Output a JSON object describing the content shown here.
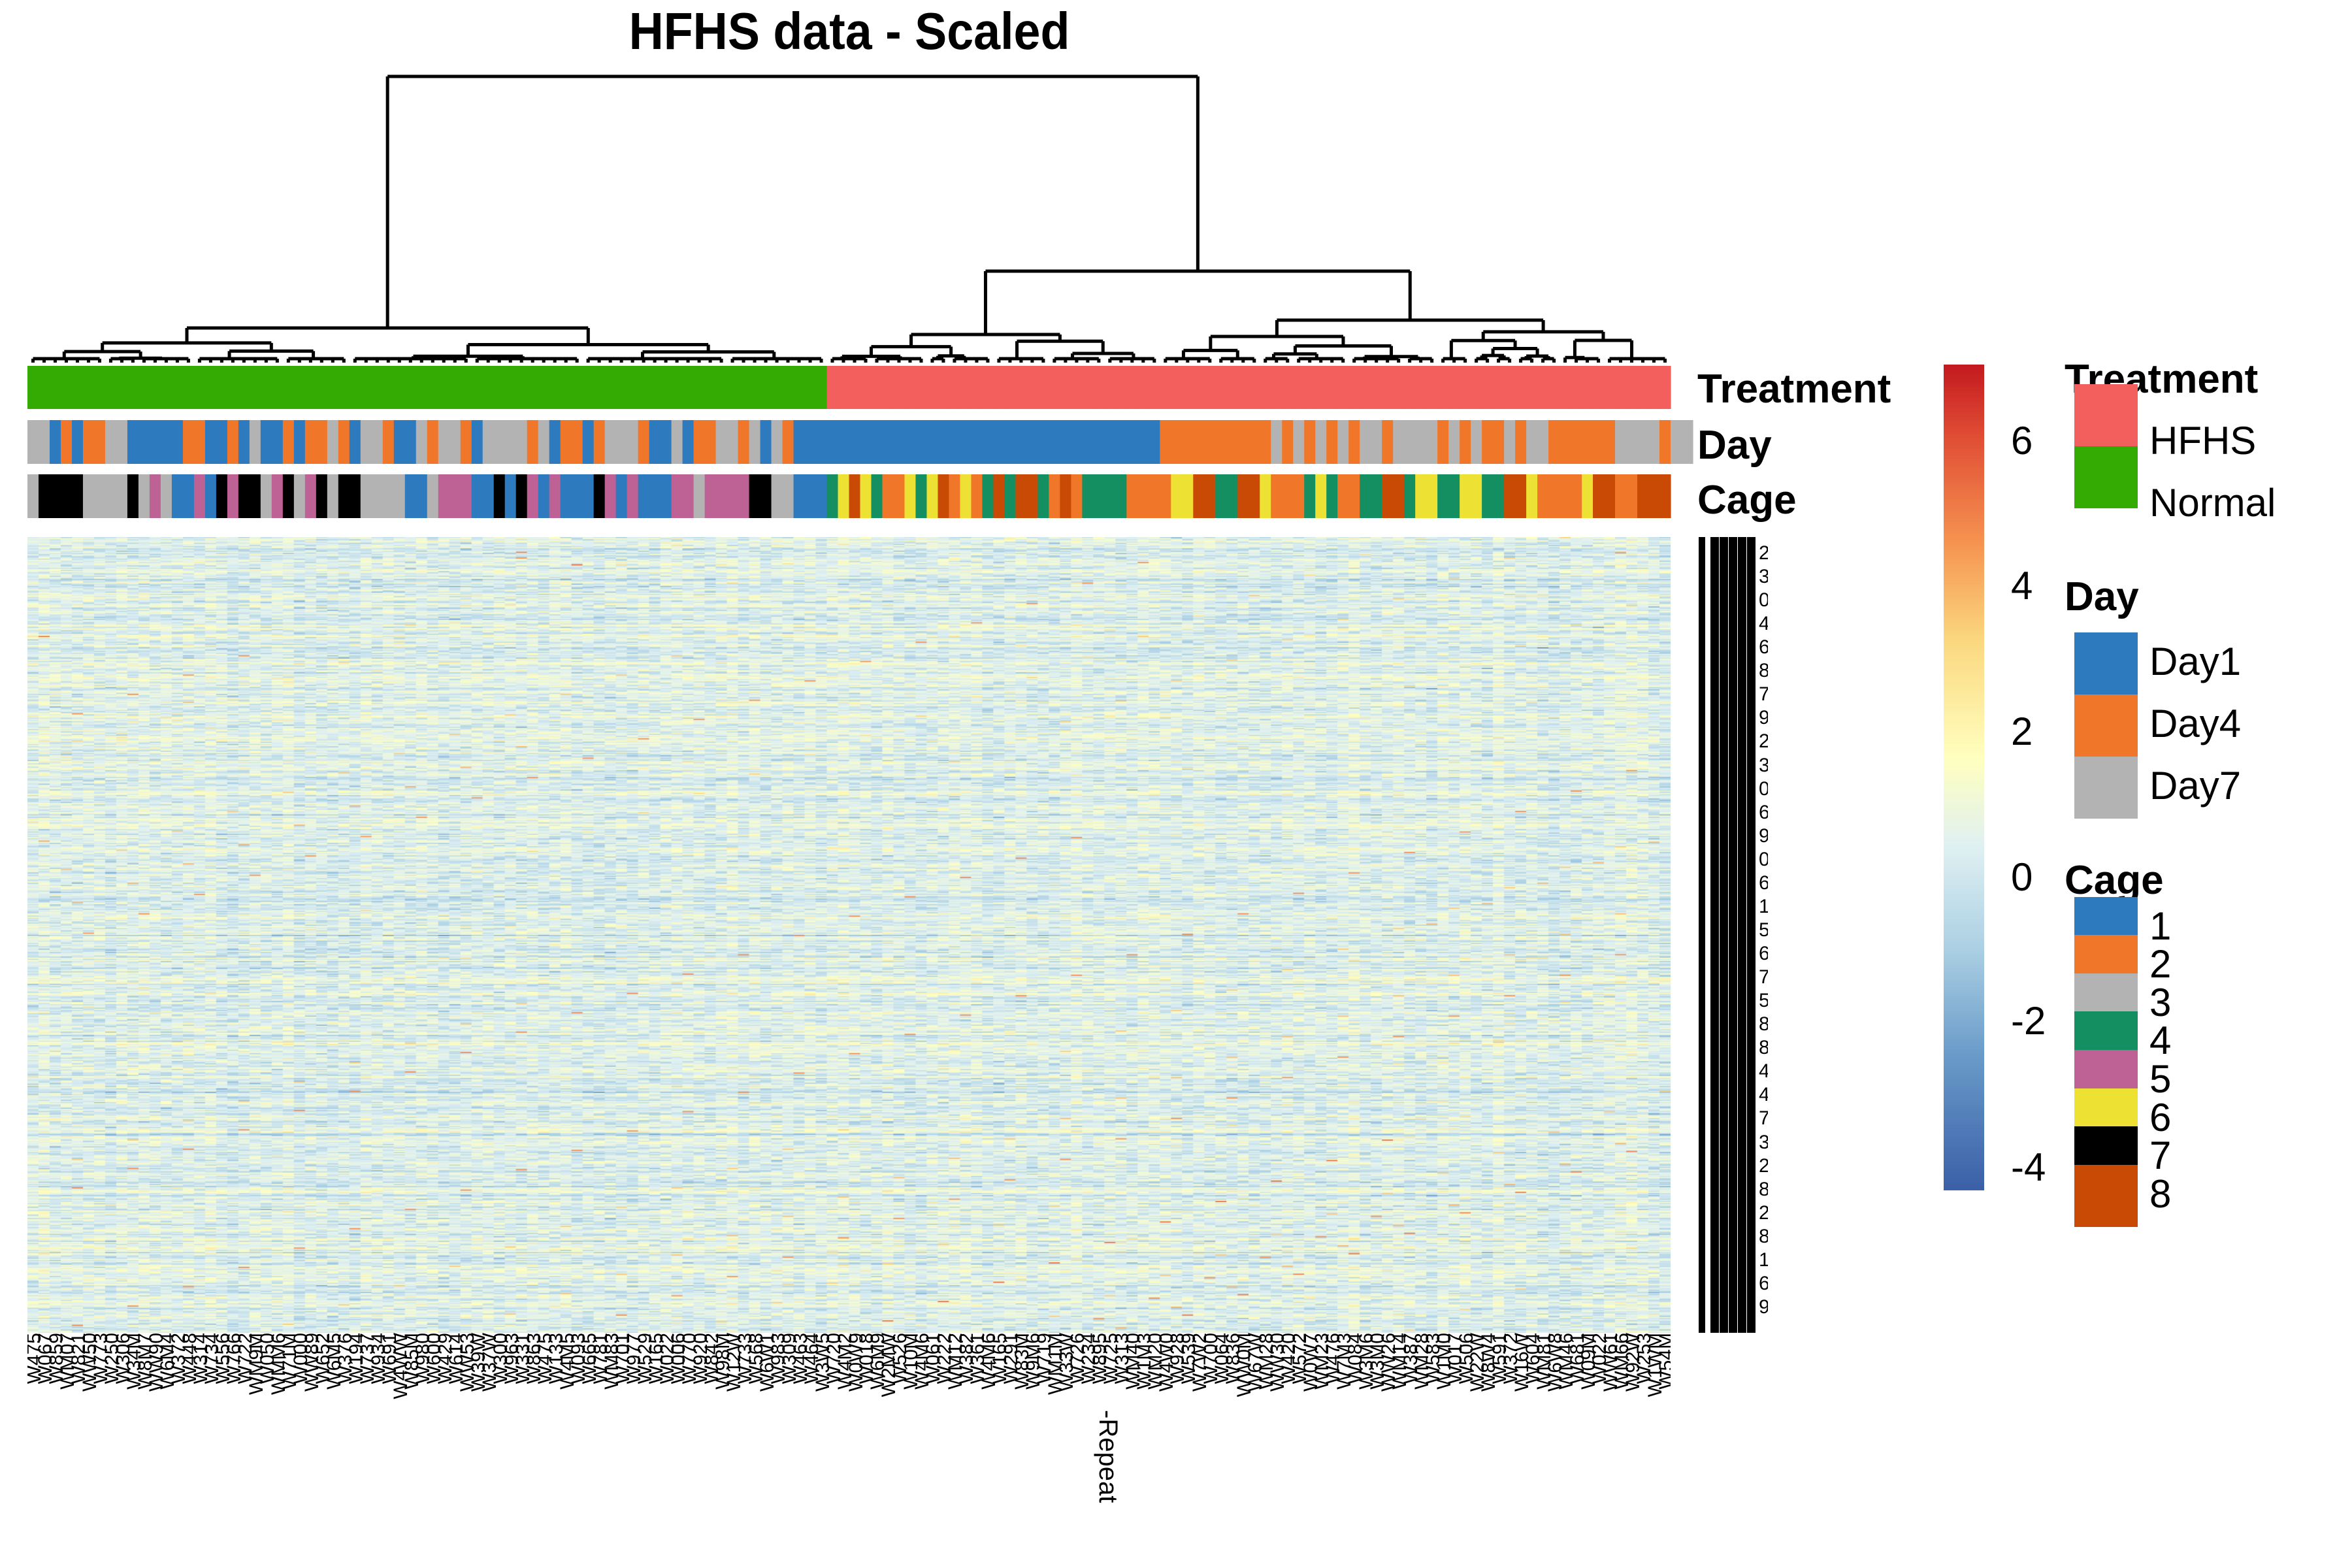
{
  "chart_data": {
    "type": "heatmap",
    "title": "HFHS data - Scaled",
    "n_columns": 148,
    "n_rows_approx": 700,
    "column_labels_note": "sample IDs rendered rotated and heavily overlapped (illegible)",
    "visible_column_label_fragment": "-Repeat",
    "row_labels_note": "feature IDs rendered heavily overlapped (illegible)",
    "visible_row_label_digits": [
      "2",
      "3",
      "0",
      "4",
      "6",
      "8",
      "7",
      "9",
      "2",
      "3",
      "0",
      "6",
      "9",
      "0",
      "6",
      "1",
      "5",
      "6",
      "7",
      "5",
      "8",
      "8",
      "4",
      "4",
      "7",
      "3",
      "2",
      "8",
      "2",
      "8",
      "1",
      "6",
      "9"
    ],
    "value_scale": {
      "min": -5,
      "max": 7,
      "ticks": [
        6,
        4,
        2,
        0,
        -2,
        -4
      ],
      "colors": [
        "#3a5fa8",
        "#6a9bc9",
        "#aacfe3",
        "#dff0f2",
        "#ffffbf",
        "#fbd880",
        "#f5904f",
        "#e04c34",
        "#c41a1f"
      ],
      "stops": [
        -5,
        -3,
        -1.5,
        0,
        1.3,
        3,
        4.5,
        6,
        7
      ]
    },
    "dendrogram": {
      "orientation": "columns",
      "top_split": "Normal vs HFHS",
      "hfhs_subsplit": "Day1 vs Day4/Day7"
    },
    "annotations": {
      "rows": [
        "Treatment",
        "Day",
        "Cage"
      ],
      "Treatment": "NNNNNNNNNNNNNNNNNNNNNNNNNNNNNNNNNNNNNNNNNNNNNNNNNNNNNNNNNNNNNNNNNNNNNNNNNNNNNNNNHHHHHHHHHHHHHHHHHHHHHHHHHHHHHHHHHHHHHHHHHHHHHHHHHHHHHHHHHHHHHHHHHH",
      "Day": "77141447711111441414711444714471144171144777714771411711777741471171441144111444111111111111111111111111114444444444477474747477477477777777474744477474744444444777777777474477",
      "Cage": "37773777373521517577377775511535575377375557777115757115551733551117555557731"
    },
    "annotation_sequences": {
      "Treatment": [
        "Normal",
        "Normal",
        "Normal",
        "Normal",
        "Normal",
        "Normal",
        "Normal",
        "Normal",
        "Normal",
        "Normal",
        "Normal",
        "Normal",
        "Normal",
        "Normal",
        "Normal",
        "Normal",
        "Normal",
        "Normal",
        "Normal",
        "Normal",
        "Normal",
        "Normal",
        "Normal",
        "Normal",
        "Normal",
        "Normal",
        "Normal",
        "Normal",
        "Normal",
        "Normal",
        "Normal",
        "Normal",
        "Normal",
        "Normal",
        "Normal",
        "Normal",
        "Normal",
        "Normal",
        "Normal",
        "Normal",
        "Normal",
        "Normal",
        "Normal",
        "Normal",
        "Normal",
        "Normal",
        "Normal",
        "Normal",
        "Normal",
        "Normal",
        "Normal",
        "Normal",
        "Normal",
        "Normal",
        "Normal",
        "Normal",
        "Normal",
        "Normal",
        "Normal",
        "Normal",
        "Normal",
        "Normal",
        "Normal",
        "Normal",
        "Normal",
        "Normal",
        "Normal",
        "Normal",
        "Normal",
        "Normal",
        "Normal",
        "Normal",
        "HFHS",
        "HFHS",
        "HFHS",
        "HFHS",
        "HFHS",
        "HFHS",
        "HFHS",
        "HFHS",
        "HFHS",
        "HFHS",
        "HFHS",
        "HFHS",
        "HFHS",
        "HFHS",
        "HFHS",
        "HFHS",
        "HFHS",
        "HFHS",
        "HFHS",
        "HFHS",
        "HFHS",
        "HFHS",
        "HFHS",
        "HFHS",
        "HFHS",
        "HFHS",
        "HFHS",
        "HFHS",
        "HFHS",
        "HFHS",
        "HFHS",
        "HFHS",
        "HFHS",
        "HFHS",
        "HFHS",
        "HFHS",
        "HFHS",
        "HFHS",
        "HFHS",
        "HFHS",
        "HFHS",
        "HFHS",
        "HFHS",
        "HFHS",
        "HFHS",
        "HFHS",
        "HFHS",
        "HFHS",
        "HFHS",
        "HFHS",
        "HFHS",
        "HFHS",
        "HFHS",
        "HFHS",
        "HFHS",
        "HFHS",
        "HFHS",
        "HFHS",
        "HFHS",
        "HFHS",
        "HFHS",
        "HFHS",
        "HFHS",
        "HFHS",
        "HFHS",
        "HFHS",
        "HFHS",
        "HFHS",
        "HFHS",
        "HFHS",
        "HFHS",
        "HFHS",
        "HFHS",
        "HFHS",
        "HFHS",
        "HFHS"
      ],
      "Day": [
        "Day7",
        "Day7",
        "Day1",
        "Day4",
        "Day1",
        "Day4",
        "Day4",
        "Day7",
        "Day7",
        "Day1",
        "Day1",
        "Day1",
        "Day1",
        "Day1",
        "Day4",
        "Day4",
        "Day1",
        "Day1",
        "Day4",
        "Day1",
        "Day7",
        "Day1",
        "Day1",
        "Day4",
        "Day1",
        "Day4",
        "Day4",
        "Day7",
        "Day4",
        "Day1",
        "Day7",
        "Day7",
        "Day4",
        "Day1",
        "Day1",
        "Day7",
        "Day4",
        "Day7",
        "Day7",
        "Day4",
        "Day1",
        "Day7",
        "Day7",
        "Day7",
        "Day7",
        "Day4",
        "Day7",
        "Day1",
        "Day4",
        "Day4",
        "Day1",
        "Day4",
        "Day7",
        "Day7",
        "Day7",
        "Day4",
        "Day1",
        "Day1",
        "Day7",
        "Day1",
        "Day4",
        "Day4",
        "Day7",
        "Day7",
        "Day4",
        "Day7",
        "Day1",
        "Day7",
        "Day4",
        "Day1",
        "Day1",
        "Day1",
        "Day1",
        "Day1",
        "Day1",
        "Day1",
        "Day1",
        "Day1",
        "Day1",
        "Day1",
        "Day1",
        "Day1",
        "Day1",
        "Day1",
        "Day1",
        "Day1",
        "Day1",
        "Day1",
        "Day1",
        "Day1",
        "Day1",
        "Day1",
        "Day1",
        "Day1",
        "Day1",
        "Day1",
        "Day1",
        "Day1",
        "Day1",
        "Day1",
        "Day1",
        "Day1",
        "Day4",
        "Day4",
        "Day4",
        "Day4",
        "Day4",
        "Day4",
        "Day4",
        "Day4",
        "Day4",
        "Day4",
        "Day7",
        "Day4",
        "Day7",
        "Day4",
        "Day7",
        "Day4",
        "Day7",
        "Day4",
        "Day7",
        "Day7",
        "Day4",
        "Day7",
        "Day7",
        "Day7",
        "Day7",
        "Day4",
        "Day7",
        "Day4",
        "Day7",
        "Day4",
        "Day4",
        "Day7",
        "Day4",
        "Day7",
        "Day7",
        "Day4",
        "Day4",
        "Day4",
        "Day4",
        "Day4",
        "Day4",
        "Day7",
        "Day7",
        "Day7",
        "Day7",
        "Day4",
        "Day7",
        "Day7"
      ],
      "Cage": [
        "3",
        "7",
        "7",
        "7",
        "7",
        "3",
        "3",
        "3",
        "3",
        "7",
        "3",
        "5",
        "3",
        "1",
        "1",
        "5",
        "1",
        "7",
        "5",
        "7",
        "7",
        "3",
        "5",
        "7",
        "3",
        "5",
        "7",
        "3",
        "7",
        "7",
        "3",
        "3",
        "3",
        "3",
        "1",
        "1",
        "3",
        "5",
        "5",
        "5",
        "1",
        "1",
        "7",
        "1",
        "7",
        "5",
        "1",
        "5",
        "1",
        "1",
        "1",
        "7",
        "5",
        "1",
        "5",
        "1",
        "1",
        "1",
        "5",
        "5",
        "3",
        "5",
        "5",
        "5",
        "5",
        "7",
        "7",
        "3",
        "3",
        "1",
        "1",
        "1",
        "4",
        "6",
        "8",
        "6",
        "4",
        "2",
        "2",
        "6",
        "4",
        "6",
        "8",
        "2",
        "6",
        "2",
        "4",
        "8",
        "4",
        "8",
        "8",
        "4",
        "2",
        "8",
        "2",
        "4",
        "4",
        "4",
        "4",
        "2",
        "2",
        "2",
        "2",
        "6",
        "6",
        "8",
        "8",
        "4",
        "4",
        "8",
        "8",
        "6",
        "2",
        "2",
        "2",
        "4",
        "6",
        "4",
        "2",
        "2",
        "4",
        "4",
        "8",
        "8",
        "4",
        "6",
        "6",
        "4",
        "4",
        "6",
        "6",
        "4",
        "4",
        "8",
        "8",
        "6",
        "2",
        "2",
        "2",
        "2",
        "6",
        "8",
        "8",
        "2",
        "2",
        "8",
        "8",
        "8"
      ]
    }
  },
  "title": "HFHS data - Scaled",
  "annotation_labels": {
    "treatment": "Treatment",
    "day": "Day",
    "cage": "Cage"
  },
  "column_label_fragment": "-Repeat",
  "colorbar": {
    "ticks": [
      "6",
      "4",
      "2",
      "0",
      "-2",
      "-4"
    ]
  },
  "legends": {
    "treatment": {
      "title": "Treatment",
      "items": [
        {
          "label": "HFHS",
          "color": "#f25f5c"
        },
        {
          "label": "Normal",
          "color": "#33ab03"
        }
      ]
    },
    "day": {
      "title": "Day",
      "items": [
        {
          "label": "Day1",
          "color": "#2e7abf"
        },
        {
          "label": "Day4",
          "color": "#f0772a"
        },
        {
          "label": "Day7",
          "color": "#b3b3b3"
        }
      ]
    },
    "cage": {
      "title": "Cage",
      "items": [
        {
          "label": "1",
          "color": "#2e7abf"
        },
        {
          "label": "2",
          "color": "#f0772a"
        },
        {
          "label": "3",
          "color": "#b3b3b3"
        },
        {
          "label": "4",
          "color": "#148f62"
        },
        {
          "label": "5",
          "color": "#be6295"
        },
        {
          "label": "6",
          "color": "#ede233"
        },
        {
          "label": "7",
          "color": "#000000"
        },
        {
          "label": "8",
          "color": "#c84a05"
        }
      ]
    }
  }
}
